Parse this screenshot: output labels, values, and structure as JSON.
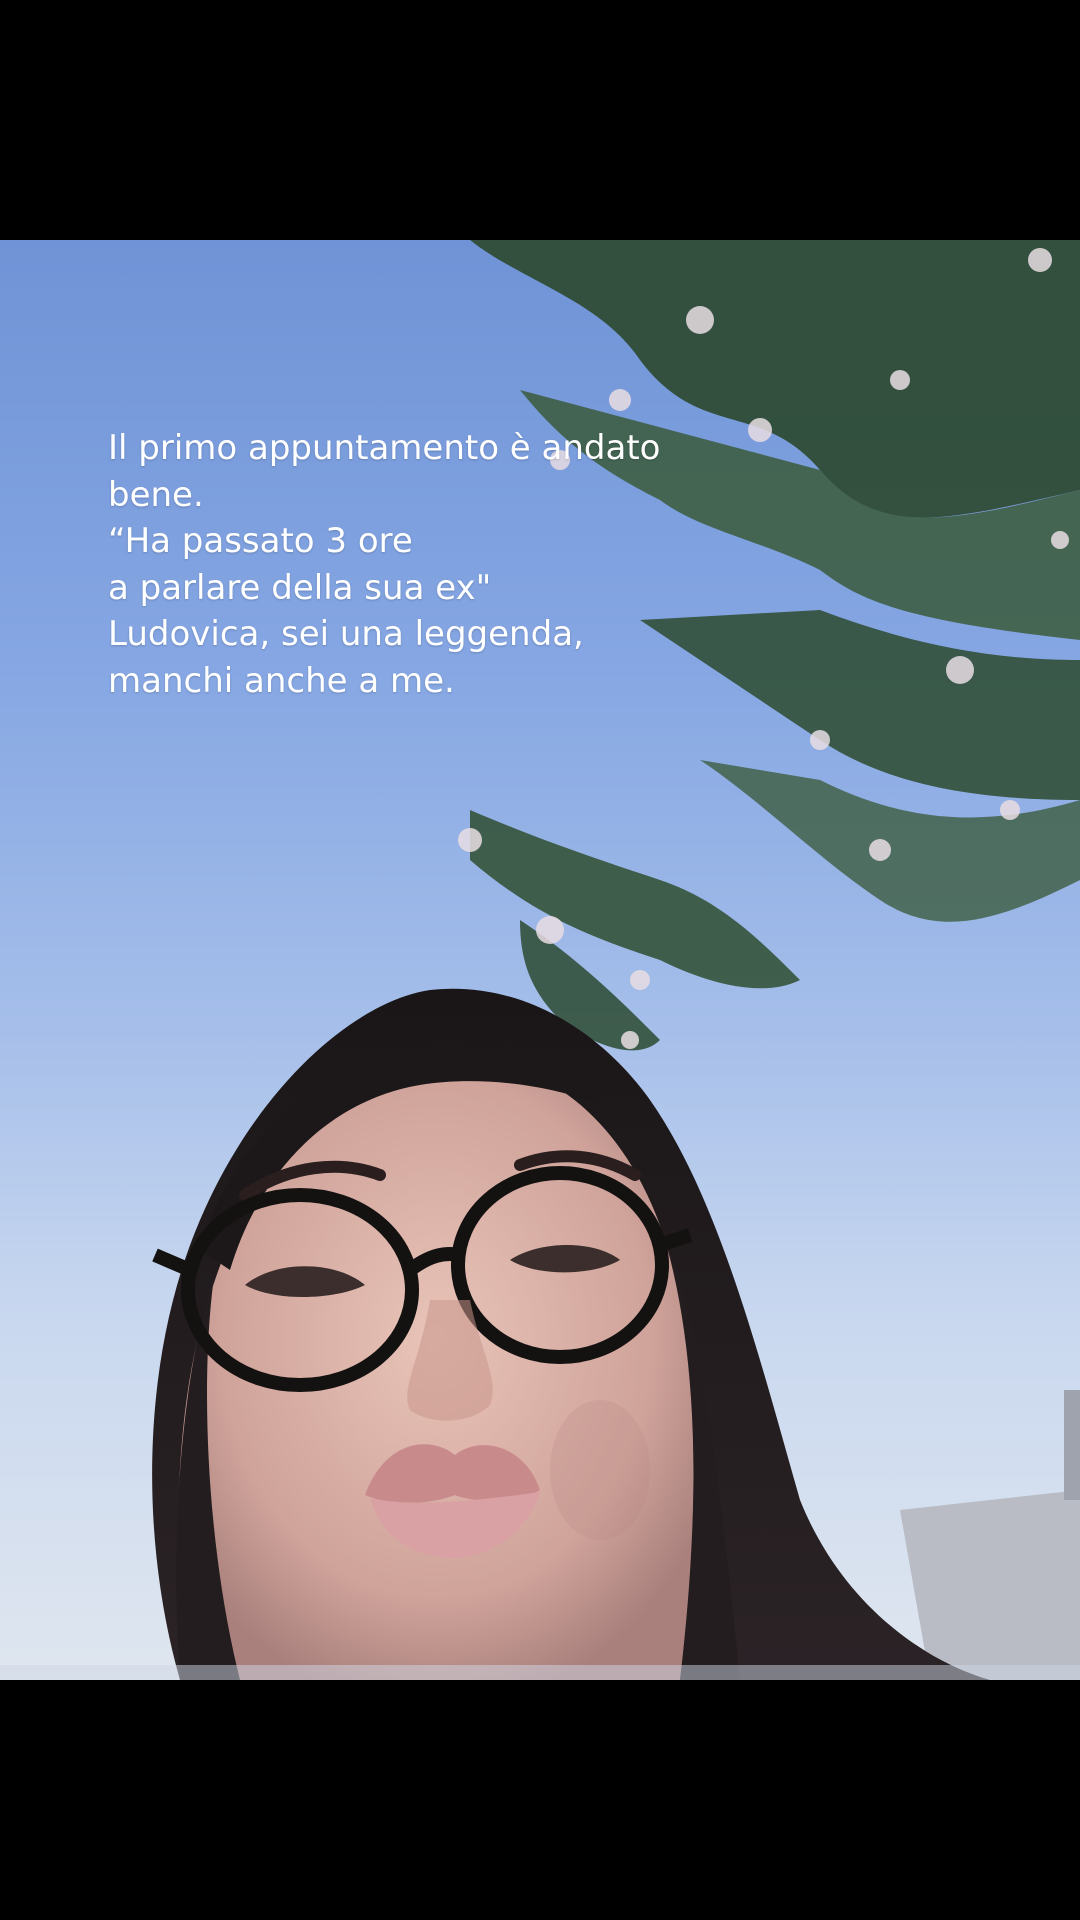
{
  "video": {
    "caption_lines": [
      "Il primo appuntamento è andato",
      "bene.",
      "“Ha passato 3 ore",
      "a parlare della sua ex\"",
      "Ludovica, sei una leggenda,",
      "manchi anche a me."
    ]
  },
  "colors": {
    "letterbox": "#000000",
    "sky_top": "#6f93d6",
    "sky_bottom": "#dfe6ef",
    "caption_text": "#ffffff",
    "foliage": "#2c4a30",
    "blossom": "#e9dde3"
  }
}
